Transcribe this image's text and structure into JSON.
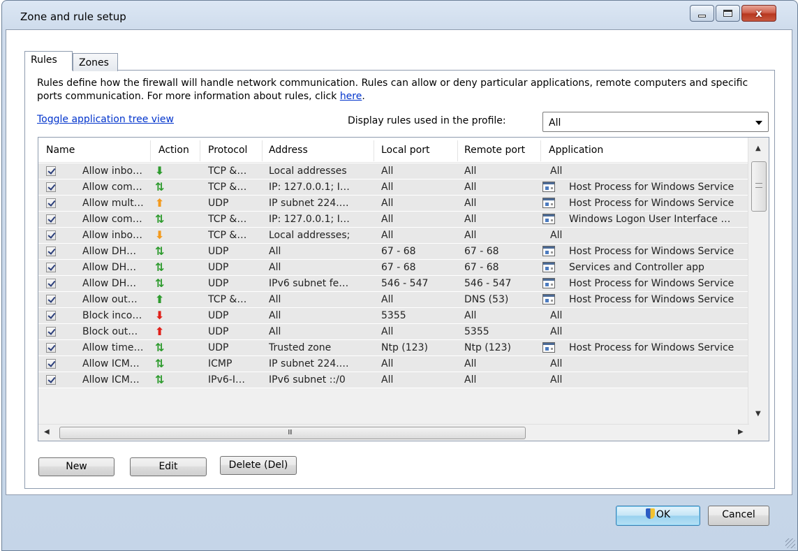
{
  "window": {
    "title": "Zone and rule setup",
    "close_glyph": "x"
  },
  "tabs": [
    {
      "label": "Rules",
      "selected": true
    },
    {
      "label": "Zones",
      "selected": false
    }
  ],
  "description": {
    "text": "Rules define how the firewall will handle network communication. Rules can allow or deny particular applications, remote computers and specific ports communication. For more information about rules, click ",
    "link": "here",
    "end": "."
  },
  "toggle_link": "Toggle application tree view",
  "profile": {
    "label": "Display rules used in the profile:",
    "selected": "All"
  },
  "columns": [
    "Name",
    "Action",
    "Protocol",
    "Address",
    "Local port",
    "Remote port",
    "Application"
  ],
  "rows": [
    {
      "name": "Allow inbo…",
      "action": "in",
      "action_icon": "arrow-down-green-icon",
      "protocol": "TCP &…",
      "address": "Local addresses",
      "local": "All",
      "remote": "All",
      "app": "All",
      "app_icon": false
    },
    {
      "name": "Allow com…",
      "action": "both",
      "action_icon": "arrows-updown-green-icon",
      "protocol": "TCP &…",
      "address": "IP: 127.0.0.1; I…",
      "local": "All",
      "remote": "All",
      "app": "Host Process for Windows Service",
      "app_icon": true
    },
    {
      "name": "Allow mult…",
      "action": "out-orange",
      "action_icon": "arrow-up-orange-icon",
      "protocol": "UDP",
      "address": "IP subnet 224.…",
      "local": "All",
      "remote": "All",
      "app": "Host Process for Windows Service",
      "app_icon": true
    },
    {
      "name": "Allow com…",
      "action": "both",
      "action_icon": "arrows-updown-green-icon",
      "protocol": "TCP &…",
      "address": "IP: 127.0.0.1; I…",
      "local": "All",
      "remote": "All",
      "app": "Windows Logon User Interface …",
      "app_icon": true
    },
    {
      "name": "Allow inbo…",
      "action": "in-orange",
      "action_icon": "arrow-down-orange-icon",
      "protocol": "TCP &…",
      "address": "Local addresses;",
      "local": "All",
      "remote": "All",
      "app": "All",
      "app_icon": false
    },
    {
      "name": "Allow DH…",
      "action": "both",
      "action_icon": "arrows-updown-green-icon",
      "protocol": "UDP",
      "address": "All",
      "local": "67 - 68",
      "remote": "67 - 68",
      "app": "Host Process for Windows Service",
      "app_icon": true
    },
    {
      "name": "Allow DH…",
      "action": "both",
      "action_icon": "arrows-updown-green-icon",
      "protocol": "UDP",
      "address": "All",
      "local": "67 - 68",
      "remote": "67 - 68",
      "app": "Services and Controller app",
      "app_icon": true
    },
    {
      "name": "Allow DH…",
      "action": "both",
      "action_icon": "arrows-updown-green-icon",
      "protocol": "UDP",
      "address": "IPv6 subnet fe…",
      "local": "546 - 547",
      "remote": "546 - 547",
      "app": "Host Process for Windows Service",
      "app_icon": true
    },
    {
      "name": "Allow out…",
      "action": "out",
      "action_icon": "arrow-up-green-icon",
      "protocol": "TCP &…",
      "address": "All",
      "local": "All",
      "remote": "DNS (53)",
      "app": "Host Process for Windows Service",
      "app_icon": true
    },
    {
      "name": "Block inco…",
      "action": "block-in",
      "action_icon": "arrow-down-red-icon",
      "protocol": "UDP",
      "address": "All",
      "local": "5355",
      "remote": "All",
      "app": "All",
      "app_icon": false
    },
    {
      "name": "Block out…",
      "action": "block-out",
      "action_icon": "arrow-up-red-icon",
      "protocol": "UDP",
      "address": "All",
      "local": "All",
      "remote": "5355",
      "app": "All",
      "app_icon": false
    },
    {
      "name": "Allow time…",
      "action": "both",
      "action_icon": "arrows-updown-green-icon",
      "protocol": "UDP",
      "address": "Trusted zone",
      "local": "Ntp (123)",
      "remote": "Ntp (123)",
      "app": "Host Process for Windows Service",
      "app_icon": true
    },
    {
      "name": "Allow ICM…",
      "action": "both",
      "action_icon": "arrows-updown-green-icon",
      "protocol": "ICMP",
      "address": "IP subnet 224.…",
      "local": "All",
      "remote": "All",
      "app": "All",
      "app_icon": false
    },
    {
      "name": "Allow ICM…",
      "action": "both",
      "action_icon": "arrows-updown-green-icon",
      "protocol": "IPv6-I…",
      "address": "IPv6 subnet ::/0",
      "local": "All",
      "remote": "All",
      "app": "All",
      "app_icon": false
    }
  ],
  "colors": {
    "green": "#2e9b2e",
    "orange": "#f39a1e",
    "red": "#e0201a"
  },
  "buttons": {
    "new": "New",
    "edit": "Edit",
    "delete": "Delete (Del)",
    "ok": "OK",
    "cancel": "Cancel"
  },
  "hscroll_grip": "III"
}
